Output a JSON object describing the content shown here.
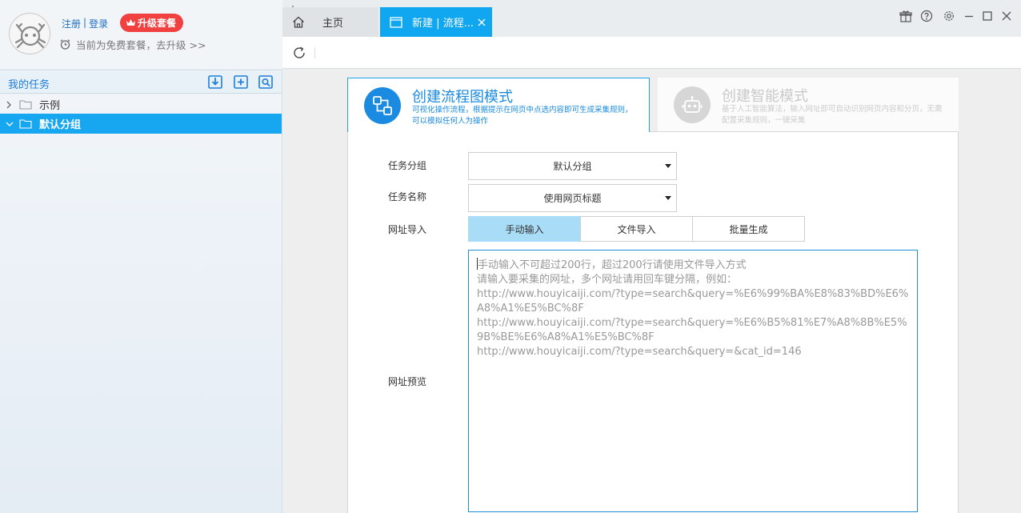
{
  "user": {
    "register": "注册",
    "separator": "|",
    "login": "登录",
    "upgrade_label": "升级套餐",
    "plan_text": "当前为免费套餐，去升级 >>"
  },
  "tasks": {
    "title": "我的任务",
    "items": [
      {
        "label": "示例",
        "expanded": false,
        "selected": false
      },
      {
        "label": "默认分组",
        "expanded": true,
        "selected": true
      }
    ]
  },
  "tabs": [
    {
      "label": "主页",
      "icon": "home-icon"
    },
    {
      "label": "新建 | 流程...",
      "icon": "window-icon",
      "active": true
    }
  ],
  "modes": {
    "flow": {
      "title": "创建流程图模式",
      "desc": "可视化操作流程，根据提示在网页中点选内容即可生成采集规则，可以模拟任何人为操作"
    },
    "smart": {
      "title": "创建智能模式",
      "desc": "基于人工智能算法，输入网址即可自动识别网页内容和分页，无需配置采集规则，一键采集"
    }
  },
  "form": {
    "group_label": "任务分组",
    "group_value": "默认分组",
    "name_label": "任务名称",
    "name_value": "使用网页标题",
    "import_label": "网址导入",
    "import_tabs": [
      "手动输入",
      "文件导入",
      "批量生成"
    ],
    "preview_label": "网址预览",
    "url_placeholder": "手动输入不可超过200行，超过200行请使用文件导入方式\n请输入要采集的网址，多个网址请用回车键分隔，例如：\nhttp://www.houyicaiji.com/?type=search&query=%E6%99%BA%E8%83%BD%E6%A8%A1%E5%BC%8F\nhttp://www.houyicaiji.com/?type=search&query=%E6%B5%81%E7%A8%8B%E5%9B%BE%E6%A8%A1%E5%BC%8F\nhttp://www.houyicaiji.com/?type=search&query=&cat_id=146"
  },
  "colors": {
    "accent": "#11a6f0",
    "upgrade": "#f04040",
    "link": "#1e6fc4"
  }
}
